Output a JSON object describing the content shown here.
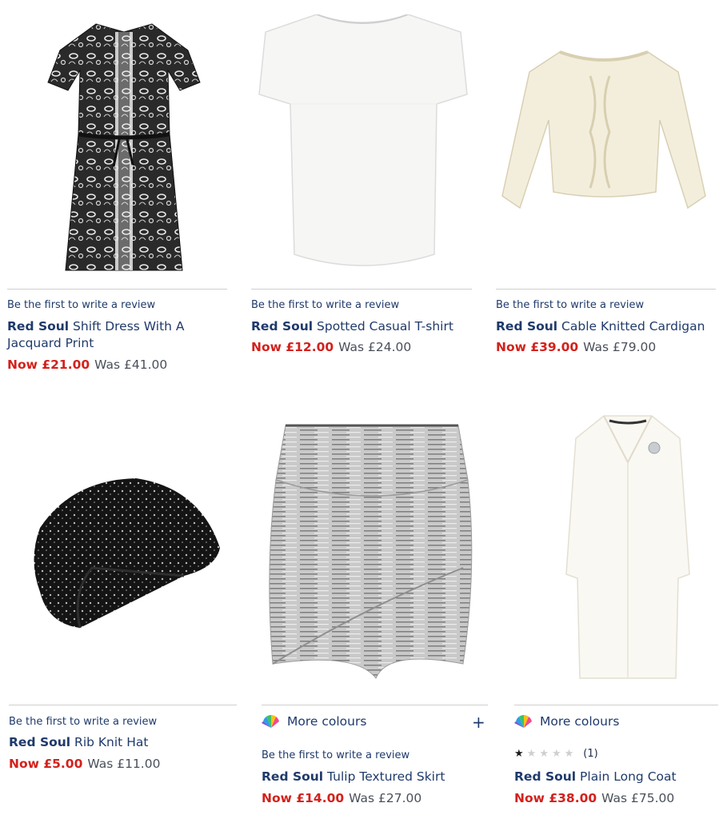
{
  "products": [
    {
      "id": "dress",
      "review": "Be the first to write a review",
      "brand": "Red Soul",
      "name": "Shift Dress With A",
      "name2": "Jacquard Print",
      "now": "Now £21.00",
      "was": "Was £41.00"
    },
    {
      "id": "tshirt",
      "review": "Be the first to write a review",
      "brand": "Red Soul",
      "name": "Spotted Casual T-shirt",
      "now": "Now £12.00",
      "was": "Was £24.00"
    },
    {
      "id": "cardigan",
      "review": "Be the first to write a review",
      "brand": "Red Soul",
      "name": "Cable Knitted Cardigan",
      "now": "Now £39.00",
      "was": "Was £79.00"
    },
    {
      "id": "hat",
      "review": "Be the first to write a review",
      "brand": "Red Soul",
      "name": "Rib Knit Hat",
      "now": "Now £5.00",
      "was": "Was £11.00"
    },
    {
      "id": "skirt",
      "colours": "More colours",
      "expand": "+",
      "review": "Be the first to write a review",
      "brand": "Red Soul",
      "name": "Tulip Textured Skirt",
      "now": "Now £14.00",
      "was": "Was £27.00"
    },
    {
      "id": "coat",
      "colours": "More colours",
      "rating": 1,
      "rating_max": 5,
      "rating_count": "(1)",
      "brand": "Red Soul",
      "name": "Plain Long Coat",
      "now": "Now £38.00",
      "was": "Was £75.00"
    }
  ],
  "colors": {
    "price_now": "#d3211c",
    "link": "#1f3a6b",
    "was": "#4a4f5a"
  },
  "icons": {
    "colour_wheel": "colour-wheel-icon",
    "star": "star-icon"
  }
}
